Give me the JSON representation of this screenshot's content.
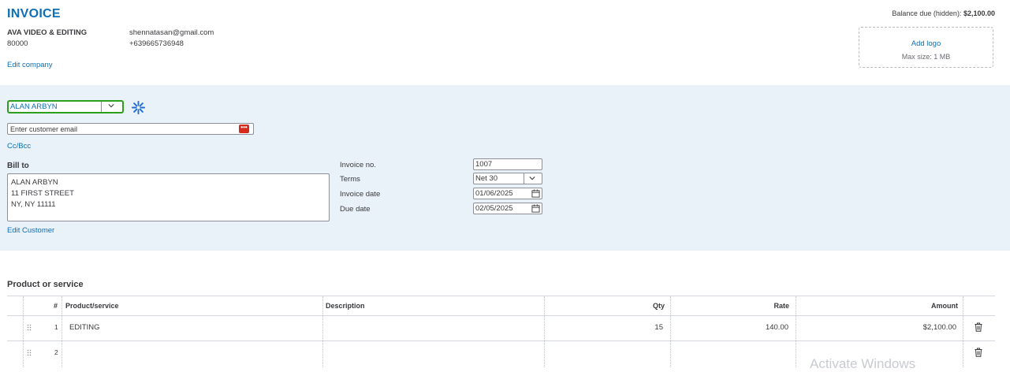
{
  "header": {
    "title": "INVOICE",
    "balance_label": "Balance due (hidden):",
    "balance_value": "$2,100.00"
  },
  "company": {
    "name": "AVA VIDEO & EDITING",
    "code": "80000",
    "email": "shennatasan@gmail.com",
    "phone": "+639665736948",
    "edit_link": "Edit company"
  },
  "logo": {
    "add_label": "Add logo",
    "max_size": "Max size: 1 MB"
  },
  "customer": {
    "selected": "ALAN ARBYN",
    "email_placeholder": "Enter customer email",
    "ccbcc_link": "Cc/Bcc",
    "bill_to_label": "Bill to",
    "bill_to_lines": [
      "ALAN ARBYN",
      "11 FIRST STREET",
      "NY, NY  11111"
    ],
    "edit_link": "Edit Customer"
  },
  "fields": {
    "invoice_no_label": "Invoice no.",
    "invoice_no": "1007",
    "terms_label": "Terms",
    "terms": "Net 30",
    "invoice_date_label": "Invoice date",
    "invoice_date": "01/06/2025",
    "due_date_label": "Due date",
    "due_date": "02/05/2025"
  },
  "products": {
    "heading": "Product or service",
    "columns": {
      "num": "#",
      "product": "Product/service",
      "description": "Description",
      "qty": "Qty",
      "rate": "Rate",
      "amount": "Amount"
    },
    "rows": [
      {
        "num": "1",
        "product": "EDITING",
        "description": "",
        "qty": "15",
        "rate": "140.00",
        "amount": "$2,100.00"
      },
      {
        "num": "2",
        "product": "",
        "description": "",
        "qty": "",
        "rate": "",
        "amount": ""
      }
    ]
  },
  "watermark": "Activate Windows",
  "colors": {
    "accent": "#0d6fb5",
    "band": "#e9f1f9",
    "focus": "#2ca01c",
    "alert": "#d52b1e"
  }
}
